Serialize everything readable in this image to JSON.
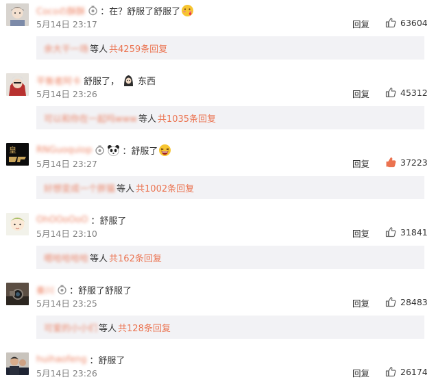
{
  "ui": {
    "reply_label": "回复",
    "etc_label": "等人"
  },
  "comments": [
    {
      "username": "Cocoの酥酥",
      "text": "：在？舒服了舒服了",
      "time": "5月14日 23:17",
      "likes": "63604",
      "liked": false,
      "avatar_icon": "anime-boy-avatar",
      "sub_users": "余大干一场",
      "sub_link": "共4259条回复"
    },
    {
      "username": "平衡者阿卡",
      "text": "舒服了，",
      "text2": "东西",
      "time": "5月14日 23:26",
      "likes": "45312",
      "liked": false,
      "avatar_icon": "warrior-avatar",
      "sub_users": "可以和你在一起吗www",
      "sub_link": "共1035条回复"
    },
    {
      "username": "RNGuoquiop",
      "text": "：舒服了",
      "time": "5月14日 23:27",
      "likes": "37223",
      "liked": true,
      "avatar_icon": "dark-logo-avatar",
      "sub_users": "好想变成一个胖猫",
      "sub_link": "共1002条回复"
    },
    {
      "username": "OhOOoOoO",
      "text": "：舒服了",
      "time": "5月14日 23:10",
      "likes": "31841",
      "liked": false,
      "avatar_icon": "cartoon-boy-avatar",
      "sub_users": "嗯哈哈哈哈",
      "sub_link": "共162条回复"
    },
    {
      "username": "秦川",
      "text": "：舒服了舒服了",
      "time": "5月14日 23:25",
      "likes": "28483",
      "liked": false,
      "avatar_icon": "camera-avatar",
      "sub_users": "可爱的小小们",
      "sub_link": "共128条回复"
    },
    {
      "username": "huihaofeng",
      "text": "：舒服了",
      "time": "5月14日 23:26",
      "likes": "26174",
      "liked": false,
      "avatar_icon": "man-photo-avatar",
      "sub_users": "",
      "sub_link": ""
    }
  ],
  "colors": {
    "accent": "#eb7350",
    "like_active": "#eb7350",
    "muted": "#808080",
    "sub_bg": "#f2f2f5"
  }
}
